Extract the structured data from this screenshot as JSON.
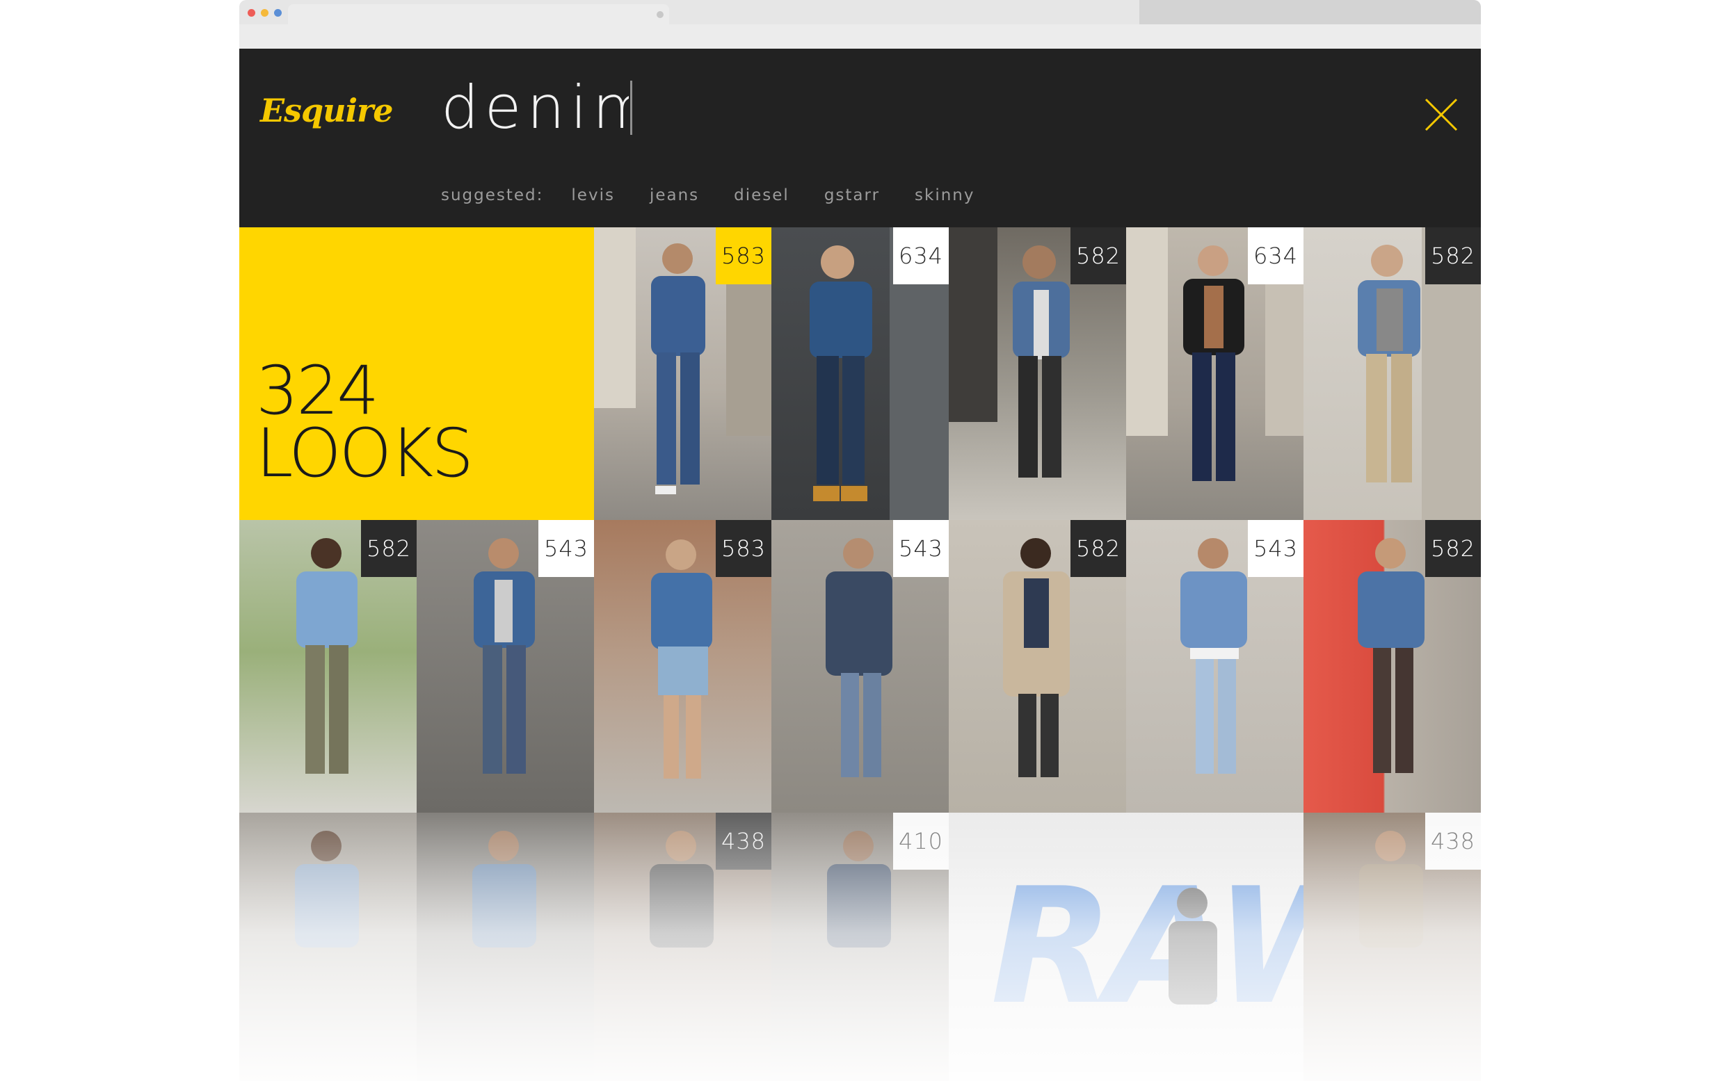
{
  "brand": {
    "logo_text": "Esquire",
    "accent_color": "#ffd600",
    "logo_color": "#f5c800"
  },
  "search": {
    "query": "denim"
  },
  "suggested": {
    "label": "suggested:",
    "items": [
      "levis",
      "jeans",
      "diesel",
      "gstarr",
      "skinny"
    ]
  },
  "results": {
    "count": "324",
    "unit": "LOOKS"
  },
  "grid": {
    "row1": [
      {
        "count": "583",
        "badge": "yellow"
      },
      {
        "count": "634",
        "badge": "white"
      },
      {
        "count": "582",
        "badge": "dark"
      },
      {
        "count": "634",
        "badge": "white"
      },
      {
        "count": "582",
        "badge": "dark"
      }
    ],
    "row2": [
      {
        "count": "582",
        "badge": "dark"
      },
      {
        "count": "543",
        "badge": "white"
      },
      {
        "count": "583",
        "badge": "dark"
      },
      {
        "count": "543",
        "badge": "white"
      },
      {
        "count": "582",
        "badge": "dark"
      },
      {
        "count": "543",
        "badge": "white"
      },
      {
        "count": "582",
        "badge": "dark"
      }
    ],
    "row3": [
      {
        "count": "438",
        "badge": "dark"
      },
      {
        "count": "410",
        "badge": "white"
      },
      {
        "count": "438",
        "badge": "white"
      }
    ],
    "ad_text": "RAW"
  },
  "icons": {
    "close": "close-icon"
  }
}
